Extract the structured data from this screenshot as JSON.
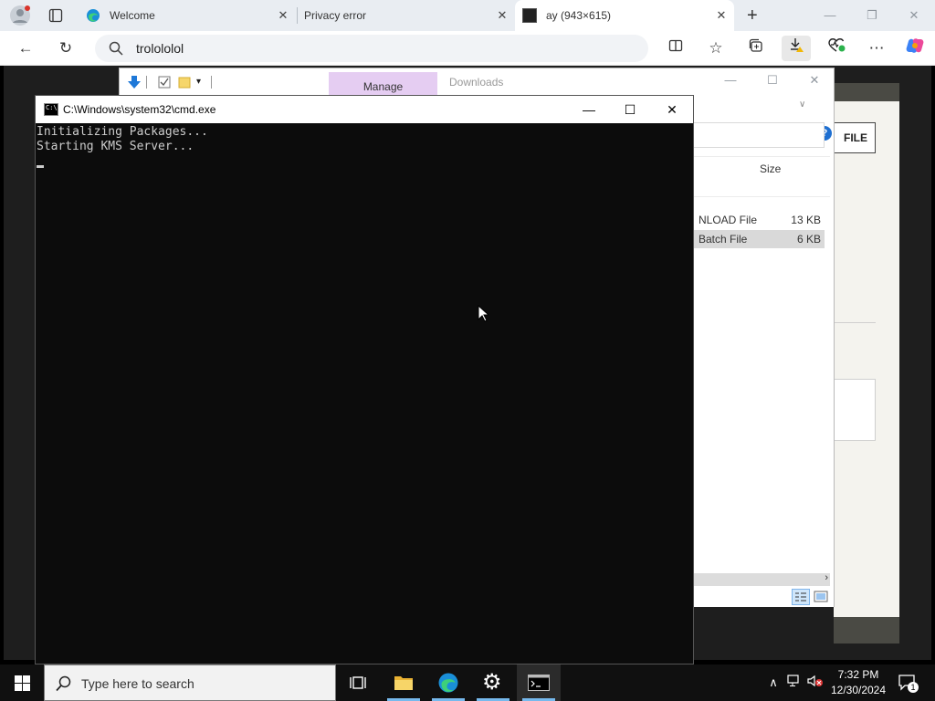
{
  "browser": {
    "tabs": [
      {
        "label": "Welcome",
        "active": false
      },
      {
        "label": "Privacy error",
        "active": false
      },
      {
        "label": "ay (943×615)",
        "active": true
      }
    ],
    "address": "trolololol"
  },
  "explorer": {
    "manage_label": "Manage",
    "location_label": "Downloads",
    "size_header": "Size",
    "files": [
      {
        "name": "NLOAD File",
        "size": "13 KB",
        "selected": false
      },
      {
        "name": " Batch File",
        "size": "6 KB",
        "selected": true
      }
    ]
  },
  "page": {
    "file_button": "FILE"
  },
  "cmd": {
    "title": "C:\\Windows\\system32\\cmd.exe",
    "output": "Initializing Packages...\nStarting KMS Server..."
  },
  "taskbar": {
    "search_placeholder": "Type here to search",
    "time": "7:32 PM",
    "date": "12/30/2024",
    "notification_count": "1"
  },
  "colors": {
    "accent": "#76b9ed",
    "manage_tab": "#e5cdf2",
    "console_bg": "#0c0c0c",
    "console_text": "#cccccc"
  }
}
